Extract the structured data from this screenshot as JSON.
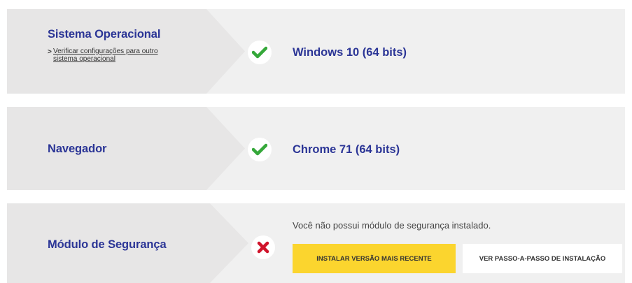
{
  "colors": {
    "panel_bg": "#f0f0f0",
    "arrow_bg": "#e7e6e6",
    "heading_blue": "#2b3596",
    "check_green": "#35a83a",
    "error_red": "#d0142b",
    "install_yellow": "#fbd52e"
  },
  "rows": {
    "os": {
      "label": "Sistema Operacional",
      "link": "Verificar configurações para outro sistema operacional",
      "link_chevron": ">",
      "status_icon": "checkmark-icon",
      "value": "Windows 10 (64 bits)"
    },
    "browser": {
      "label": "Navegador",
      "status_icon": "checkmark-icon",
      "value": "Chrome 71 (64 bits)"
    },
    "security": {
      "label": "Módulo de Segurança",
      "status_icon": "cross-icon",
      "message": "Você não possui módulo de segurança instalado.",
      "install_button": "INSTALAR VERSÃO MAIS RECENTE",
      "steps_button": "VER PASSO-A-PASSO DE INSTALAÇÃO"
    }
  }
}
